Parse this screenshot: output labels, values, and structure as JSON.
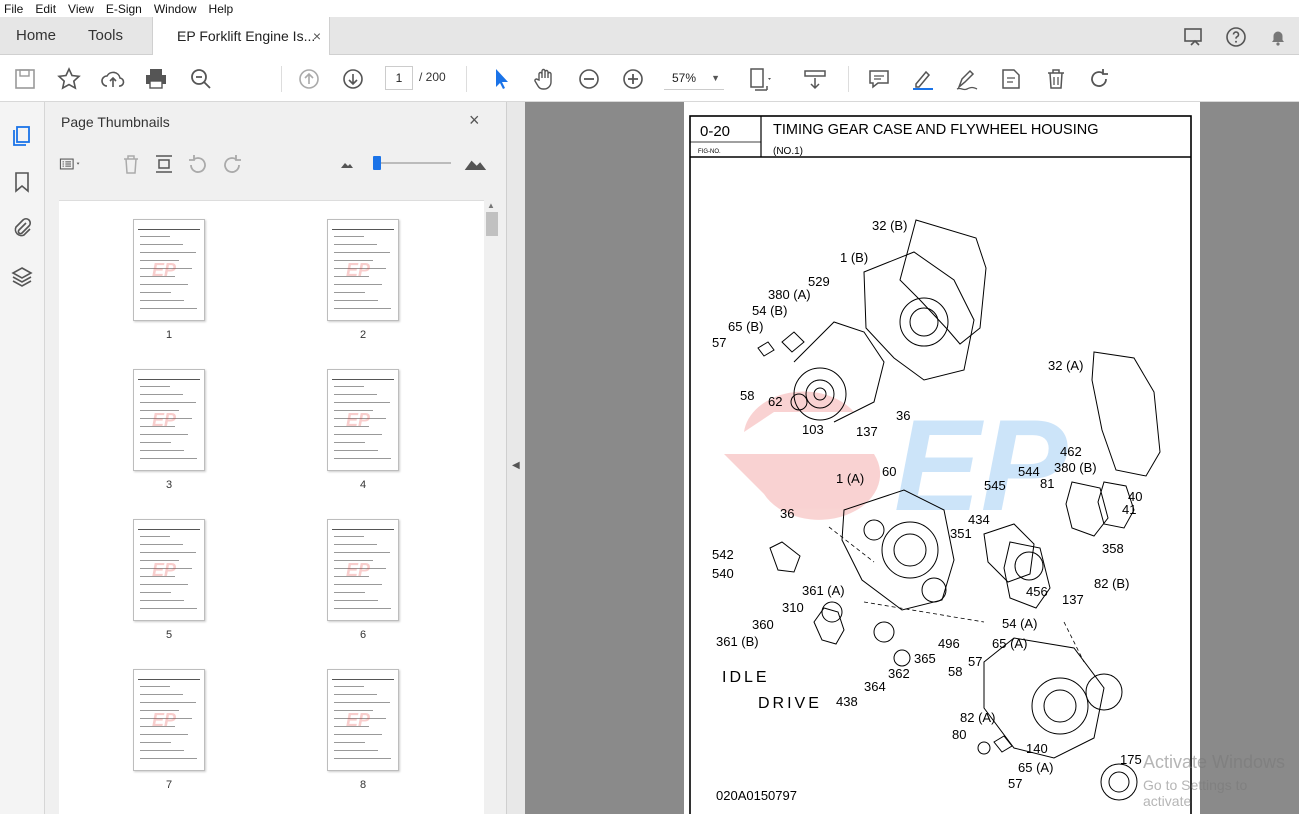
{
  "menu": [
    "File",
    "Edit",
    "View",
    "E-Sign",
    "Window",
    "Help"
  ],
  "tabs": {
    "home": "Home",
    "tools": "Tools",
    "document": "EP Forklift Engine Is...",
    "close": "×"
  },
  "toolbar": {
    "page_current": "1",
    "page_total": "/ 200",
    "zoom": "57%"
  },
  "panel": {
    "title": "Page Thumbnails",
    "close": "×"
  },
  "thumbnails": [
    "1",
    "2",
    "3",
    "4",
    "5",
    "6",
    "7",
    "8"
  ],
  "document": {
    "fig_no": "0-20",
    "fig_no_label": "FIG-NO.",
    "title": "TIMING GEAR CASE AND FLYWHEEL HOUSING",
    "subtitle": "(NO.1)",
    "doc_code": "020A0150797",
    "watermark": "EP",
    "labels": [
      {
        "t": "32 (B)"
      },
      {
        "t": "1 (B)"
      },
      {
        "t": "529"
      },
      {
        "t": "380 (A)"
      },
      {
        "t": "54 (B)"
      },
      {
        "t": "65 (B)"
      },
      {
        "t": "57"
      },
      {
        "t": "58"
      },
      {
        "t": "62"
      },
      {
        "t": "103"
      },
      {
        "t": "137"
      },
      {
        "t": "36"
      },
      {
        "t": "32 (A)"
      },
      {
        "t": "462"
      },
      {
        "t": "380 (B)"
      },
      {
        "t": "40"
      },
      {
        "t": "41"
      },
      {
        "t": "544"
      },
      {
        "t": "545"
      },
      {
        "t": "81"
      },
      {
        "t": "60"
      },
      {
        "t": "1 (A)"
      },
      {
        "t": "36"
      },
      {
        "t": "434"
      },
      {
        "t": "351"
      },
      {
        "t": "358"
      },
      {
        "t": "542"
      },
      {
        "t": "540"
      },
      {
        "t": "456"
      },
      {
        "t": "82 (B)"
      },
      {
        "t": "137"
      },
      {
        "t": "361 (A)"
      },
      {
        "t": "310"
      },
      {
        "t": "54 (A)"
      },
      {
        "t": "360"
      },
      {
        "t": "361 (B)"
      },
      {
        "t": "496"
      },
      {
        "t": "65 (A)"
      },
      {
        "t": "365"
      },
      {
        "t": "362"
      },
      {
        "t": "57"
      },
      {
        "t": "58"
      },
      {
        "t": "IDLE"
      },
      {
        "t": "364"
      },
      {
        "t": "DRIVE"
      },
      {
        "t": "438"
      },
      {
        "t": "82 (A)"
      },
      {
        "t": "80"
      },
      {
        "t": "140"
      },
      {
        "t": "65 (A)"
      },
      {
        "t": "57"
      },
      {
        "t": "175"
      }
    ]
  },
  "os_watermark": {
    "line1": "Activate Windows",
    "line2": "Go to Settings to activate"
  }
}
